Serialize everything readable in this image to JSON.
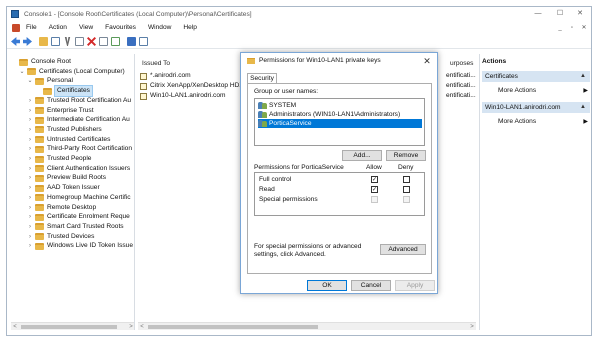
{
  "window": {
    "title": "Console1 - [Console Root\\Certificates (Local Computer)\\Personal\\Certificates]",
    "controls": {
      "minimize": "—",
      "maximize": "☐",
      "close": "✕"
    },
    "mdi_controls": {
      "minimize": "_",
      "restore": "▫",
      "close": "✕"
    }
  },
  "menu": [
    "File",
    "Action",
    "View",
    "Favourites",
    "Window",
    "Help"
  ],
  "toolbar": {
    "icons": [
      "back-arrow",
      "forward-arrow",
      "up-folder",
      "show-hide-tree",
      "cut",
      "copy",
      "delete",
      "properties",
      "export-list",
      "help",
      "show-hide-action-pane"
    ]
  },
  "tree": [
    {
      "label": "Console Root",
      "level": 0,
      "chevron": ""
    },
    {
      "label": "Certificates (Local Computer)",
      "level": 1,
      "chevron": "v"
    },
    {
      "label": "Personal",
      "level": 2,
      "chevron": "v"
    },
    {
      "label": "Certificates",
      "level": 3,
      "chevron": "",
      "selected": true
    },
    {
      "label": "Trusted Root Certification Au",
      "level": 2,
      "chevron": ">"
    },
    {
      "label": "Enterprise Trust",
      "level": 2,
      "chevron": ">"
    },
    {
      "label": "Intermediate Certification Au",
      "level": 2,
      "chevron": ">"
    },
    {
      "label": "Trusted Publishers",
      "level": 2,
      "chevron": ">"
    },
    {
      "label": "Untrusted Certificates",
      "level": 2,
      "chevron": ">"
    },
    {
      "label": "Third-Party Root Certification",
      "level": 2,
      "chevron": ">"
    },
    {
      "label": "Trusted People",
      "level": 2,
      "chevron": ">"
    },
    {
      "label": "Client Authentication Issuers",
      "level": 2,
      "chevron": ">"
    },
    {
      "label": "Preview Build Roots",
      "level": 2,
      "chevron": ">"
    },
    {
      "label": "AAD Token Issuer",
      "level": 2,
      "chevron": ">"
    },
    {
      "label": "Homegroup Machine Certific",
      "level": 2,
      "chevron": ">"
    },
    {
      "label": "Remote Desktop",
      "level": 2,
      "chevron": ">"
    },
    {
      "label": "Certificate Enrolment Reque",
      "level": 2,
      "chevron": ">"
    },
    {
      "label": "Smart Card Trusted Roots",
      "level": 2,
      "chevron": ">"
    },
    {
      "label": "Trusted Devices",
      "level": 2,
      "chevron": ">"
    },
    {
      "label": "Windows Live ID Token Issue",
      "level": 2,
      "chevron": ">"
    }
  ],
  "list": {
    "col_issued_to": "Issued To",
    "col_purposes": "urposes",
    "rows": [
      {
        "issued_to": "*.anirodri.com",
        "purpose": "entificati..."
      },
      {
        "issued_to": "Citrix XenApp/XenDesktop HDX...",
        "purpose": "entificati..."
      },
      {
        "issued_to": "Win10-LAN1.anirodri.com",
        "purpose": "entificati..."
      }
    ]
  },
  "actions": {
    "header": "Actions",
    "sections": [
      {
        "title": "Certificates",
        "items": [
          "More Actions"
        ]
      },
      {
        "title": "Win10-LAN1.anirodri.com",
        "items": [
          "More Actions"
        ]
      }
    ]
  },
  "dialog": {
    "title": "Permissions for Win10-LAN1 private keys",
    "tab": "Security",
    "group_label": "Group or user names:",
    "users": [
      "SYSTEM",
      "Administrators (WIN10-LAN1\\Administrators)",
      "PorticaService"
    ],
    "selected_user_index": 2,
    "add_label": "Add...",
    "remove_label": "Remove",
    "perm_label": "Permissions for PorticaService",
    "allow_label": "Allow",
    "deny_label": "Deny",
    "permissions": [
      {
        "name": "Full control",
        "allow": true,
        "deny": false,
        "disabled": false
      },
      {
        "name": "Read",
        "allow": true,
        "deny": false,
        "disabled": false
      },
      {
        "name": "Special permissions",
        "allow": false,
        "deny": false,
        "disabled": true
      }
    ],
    "special_note": "For special permissions or advanced settings, click Advanced.",
    "advanced_label": "Advanced",
    "ok_label": "OK",
    "cancel_label": "Cancel",
    "apply_label": "Apply"
  }
}
